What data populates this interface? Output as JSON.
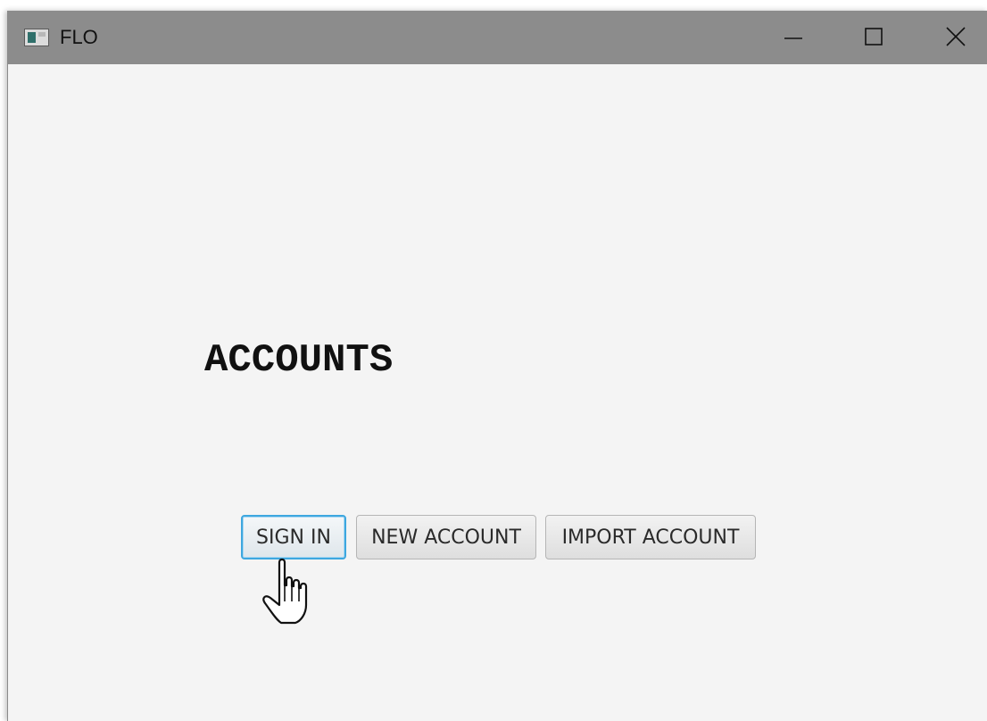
{
  "window": {
    "title": "FLO",
    "icon": "app-window-icon",
    "controls": {
      "minimize_icon": "minimize-icon",
      "maximize_icon": "maximize-icon",
      "close_icon": "close-icon"
    }
  },
  "main": {
    "heading": "ACCOUNTS",
    "buttons": {
      "sign_in": "SIGN IN",
      "new_account": "NEW ACCOUNT",
      "import_account": "IMPORT ACCOUNT"
    },
    "focused_button": "SIGN IN"
  },
  "cursor": "hand-pointer-icon",
  "colors": {
    "titlebar": "#8c8c8c",
    "background": "#f4f4f4",
    "focus_ring": "#3ea7df"
  }
}
